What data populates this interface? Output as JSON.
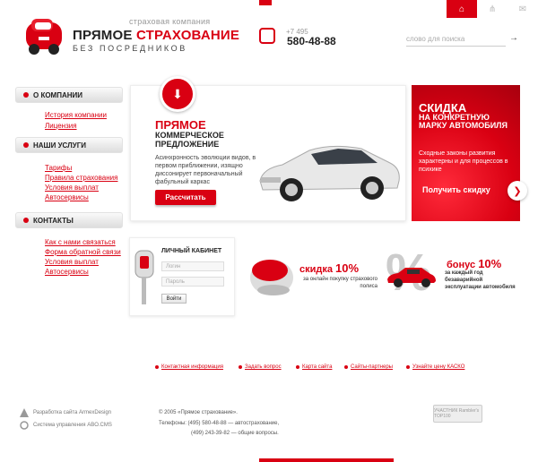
{
  "header": {
    "nav_icons": [
      "home-icon",
      "sitemap-icon",
      "mail-icon"
    ],
    "logo_small": "страховая компания",
    "logo_main_a": "ПРЯМОЕ ",
    "logo_main_b": "СТРАХОВАНИЕ",
    "logo_sub": "БЕЗ ПОСРЕДНИКОВ",
    "phone_code": "+7 495",
    "phone_number": "580-48-88",
    "search_placeholder": "слово для поиска",
    "search_arrow": "→"
  },
  "sidebar": {
    "sections": [
      {
        "title": "О КОМПАНИИ",
        "links": [
          "История компании",
          "Лицензия"
        ]
      },
      {
        "title": "НАШИ УСЛУГИ",
        "links": [
          "Тарифы",
          "Правила страхования",
          "Условия выплат",
          "Автосервисы"
        ]
      },
      {
        "title": "КОНТАКТЫ",
        "links": [
          "Как с нами связаться",
          "Форма обратной связи",
          "Условия выплат",
          "Автосервисы"
        ]
      }
    ]
  },
  "promo": {
    "title1": "ПРЯМОЕ",
    "title2": "КОММЕРЧЕСКОЕ ПРЕДЛОЖЕНИЕ",
    "text": "Асинхронность эволюции видов, в первом приближении, изящно диссонирует первоначальный фабульный каркас",
    "button": "Рассчитать"
  },
  "red_box": {
    "title1": "СКИДКА",
    "title2": "НА КОНКРЕТНУЮ МАРКУ АВТОМОБИЛЯ",
    "text": "Сходные законы развития характерны и для процессов в психике",
    "button": "Получить скидку"
  },
  "login": {
    "title": "ЛИЧНЫЙ КАБИНЕТ",
    "login_placeholder": "Логин",
    "password_placeholder": "Пароль",
    "button": "Войти"
  },
  "discount": {
    "word": "скидка ",
    "value": "10%",
    "text": "за онлайн покупку страхового полиса"
  },
  "bonus": {
    "word": "бонус ",
    "value": "10%",
    "symbol": "%",
    "text": "за каждый год безаварийной эксплуатации автомобиля"
  },
  "footer": {
    "links": [
      "Контактная информация",
      "Задать вопрос",
      "Карта сайта",
      "Сайты-партнеры",
      "Узнайте цену КАСКО"
    ],
    "dev1": "Разработка сайта ArmexDesign",
    "dev2": "Система управления ABO.CMS",
    "copyright": "© 2005 «Прямое страхование».",
    "tel1": "Телефоны: (495) 580-48-88 — автострахование,",
    "tel2": "(499) 243-39-82 — общие вопросы.",
    "counter": "УЧАСТНИК Rambler's TOP100"
  },
  "colors": {
    "accent": "#d90012"
  }
}
